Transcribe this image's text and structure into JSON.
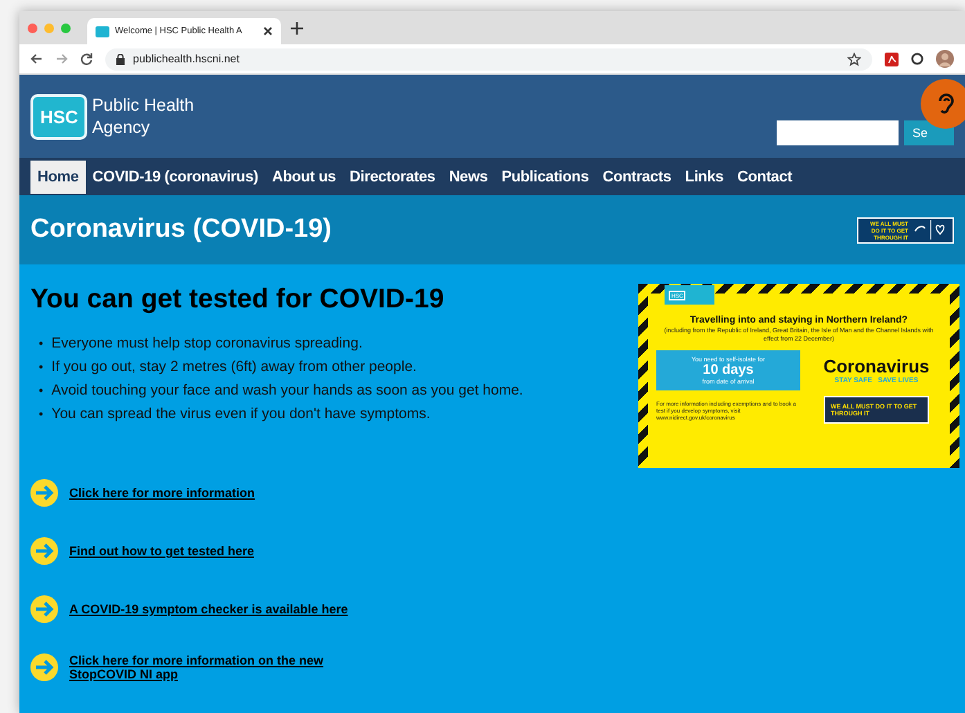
{
  "browser": {
    "tab_title": "Welcome | HSC Public Health A",
    "url": "publichealth.hscni.net"
  },
  "header": {
    "logo_text": "HSC",
    "agency_line1": "Public Health",
    "agency_line2": "Agency",
    "search_button": "Se"
  },
  "nav": [
    {
      "label": "Home",
      "selected": true
    },
    {
      "label": "COVID-19 (coronavirus)",
      "selected": false
    },
    {
      "label": "About us",
      "selected": false
    },
    {
      "label": "Directorates",
      "selected": false
    },
    {
      "label": "News",
      "selected": false
    },
    {
      "label": "Publications",
      "selected": false
    },
    {
      "label": "Contracts",
      "selected": false
    },
    {
      "label": "Links",
      "selected": false
    },
    {
      "label": "Contact",
      "selected": false
    }
  ],
  "page_title": "Coronavirus (COVID-19)",
  "title_badge": "WE ALL MUST DO IT TO GET THROUGH IT",
  "heading": "You can get tested for COVID-19",
  "bullets": [
    {
      "marker": "•",
      "text": "Everyone must help stop coronavirus spreading."
    },
    {
      "marker": "•",
      "text": "If you go out, stay 2 metres (6ft) away from other people."
    },
    {
      "marker": "•",
      "text": "Avoid touching your face and wash your hands as soon as you get home."
    },
    {
      "marker": "•",
      "text": "You can spread the virus even if you don't have symptoms."
    }
  ],
  "poster": {
    "logo_text": "HSC",
    "title": "Travelling into and staying in Northern Ireland?",
    "subtitle": "(including from the Republic of Ireland, Great Britain, the Isle of Man and the Channel Islands with effect from 22 December)",
    "box_line1": "You need to self-isolate for",
    "box_big": "10 days",
    "box_line2": "from date of arrival",
    "footnote": "For more information including exemptions and to book a test if you develop symptoms, visit www.nidirect.gov.uk/coronavirus",
    "brand": "Coronavirus",
    "slogan": "STAY SAFE   SAVE LIVES",
    "badge": "WE ALL MUST DO IT TO GET THROUGH IT"
  },
  "links": [
    "Click here for more information",
    "Find out how to get tested here",
    "A COVID-19 symptom checker is available here",
    "Click here for more information on the new StopCOVID NI app"
  ]
}
